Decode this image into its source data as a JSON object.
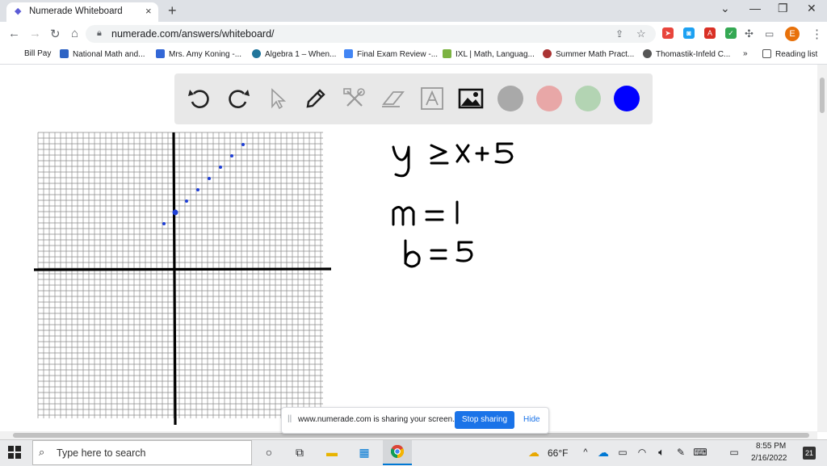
{
  "browser": {
    "tab_title": "Numerade Whiteboard",
    "tab_close": "×",
    "new_tab": "+",
    "url": "numerade.com/answers/whiteboard/",
    "profile_initial": "E",
    "window_controls": [
      "⌄",
      "—",
      "❐",
      "✕"
    ]
  },
  "bookmarks": [
    {
      "label": "Bill Pay",
      "color": ""
    },
    {
      "label": "National Math and...",
      "color": "#2f64c4"
    },
    {
      "label": "Mrs. Amy Koning -...",
      "color": "#3367d6"
    },
    {
      "label": "Algebra 1 – When...",
      "color": "#21759b"
    },
    {
      "label": "Final Exam Review -...",
      "color": "#4285f4"
    },
    {
      "label": "IXL | Math, Languag...",
      "color": "#7cb342"
    },
    {
      "label": "Summer Math Pract...",
      "color": "#a33"
    },
    {
      "label": "Thomastik-Infeld C...",
      "color": "#555"
    },
    {
      "label": "»",
      "color": ""
    },
    {
      "label": "Reading list",
      "color": ""
    }
  ],
  "whiteboard": {
    "tools": [
      "undo",
      "redo",
      "select",
      "pen",
      "tools",
      "eraser",
      "text",
      "image"
    ],
    "colors": [
      "#a9a9a9",
      "#e8a7a7",
      "#b3d4b3",
      "#0000ff"
    ],
    "equation": "y ≥ x+5",
    "slope": "m=1",
    "intercept": "b=5",
    "points": [
      [
        -1,
        4
      ],
      [
        0,
        5
      ],
      [
        1,
        6
      ],
      [
        2,
        7
      ],
      [
        3,
        8
      ],
      [
        4,
        9
      ],
      [
        5,
        10
      ],
      [
        6,
        11
      ]
    ]
  },
  "share_bar": {
    "grip": "||",
    "message": "www.numerade.com is sharing your screen.",
    "stop_label": "Stop sharing",
    "hide_label": "Hide"
  },
  "taskbar": {
    "search_placeholder": "Type here to search",
    "temperature": "66°F",
    "time": "8:55 PM",
    "date": "2/16/2022",
    "notifications": "21"
  }
}
